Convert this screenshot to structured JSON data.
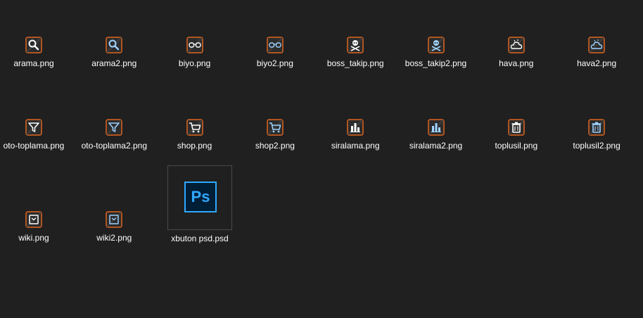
{
  "files": [
    {
      "name": "arama.png",
      "icon": "search-icon",
      "accent": "#ffffff"
    },
    {
      "name": "arama2.png",
      "icon": "search-icon",
      "accent": "#9fd3ff"
    },
    {
      "name": "biyo.png",
      "icon": "glasses-icon",
      "accent": "#ffffff"
    },
    {
      "name": "biyo2.png",
      "icon": "glasses-icon",
      "accent": "#9fd3ff"
    },
    {
      "name": "boss_takip.png",
      "icon": "skull-crossbones-icon",
      "accent": "#ffffff"
    },
    {
      "name": "boss_takip2.png",
      "icon": "skull-crossbones-icon",
      "accent": "#9fd3ff"
    },
    {
      "name": "hava.png",
      "icon": "weather-cloud-icon",
      "accent": "#ffffff"
    },
    {
      "name": "hava2.png",
      "icon": "weather-cloud-icon",
      "accent": "#9fd3ff"
    },
    {
      "name": "oto-toplama.png",
      "icon": "funnel-icon",
      "accent": "#ffffff"
    },
    {
      "name": "oto-toplama2.png",
      "icon": "funnel-icon",
      "accent": "#9fd3ff"
    },
    {
      "name": "shop.png",
      "icon": "shopping-cart-icon",
      "accent": "#ffffff"
    },
    {
      "name": "shop2.png",
      "icon": "shopping-cart-icon",
      "accent": "#9fd3ff"
    },
    {
      "name": "siralama.png",
      "icon": "bar-chart-icon",
      "accent": "#ffffff"
    },
    {
      "name": "siralama2.png",
      "icon": "bar-chart-icon",
      "accent": "#9fd3ff"
    },
    {
      "name": "toplusil.png",
      "icon": "trash-icon",
      "accent": "#ffffff"
    },
    {
      "name": "toplusil2.png",
      "icon": "trash-icon",
      "accent": "#9fd3ff"
    },
    {
      "name": "wiki.png",
      "icon": "book-icon",
      "accent": "#ffffff"
    },
    {
      "name": "wiki2.png",
      "icon": "book-icon",
      "accent": "#9fd3ff"
    },
    {
      "name": "xbuton psd.psd",
      "icon": "photoshop-icon",
      "accent": "#31a8ff"
    }
  ],
  "colors": {
    "background": "#202020",
    "thumb_border": "#e0651f",
    "thumb_fill": "#2b2b2b",
    "label": "#ffffff",
    "ps_bg": "#001e36",
    "ps_text": "#31a8ff"
  },
  "ps_glyph": "Ps"
}
